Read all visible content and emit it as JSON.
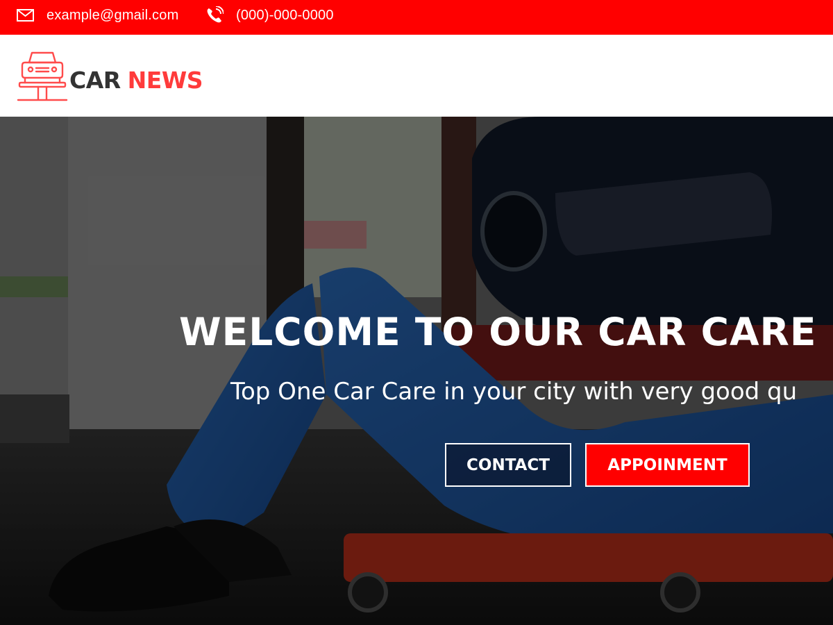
{
  "topbar": {
    "email": "example@gmail.com",
    "phone": "(000)-000-0000",
    "background": "#ff0000",
    "email_icon": "envelope-icon",
    "phone_icon": "phone-ringing-icon"
  },
  "header": {
    "logo_icon": "car-lift-icon",
    "logo_word1": "CAR",
    "logo_word2": "NEWS",
    "logo_accent": "#ff3b3b"
  },
  "hero": {
    "title": "WELCOME TO OUR CAR CARE I",
    "subtitle": "Top One Car Care in your city with very good qu",
    "contact_label": "CONTACT",
    "appointment_label": "APPOINMENT",
    "accent": "#ff0000"
  }
}
